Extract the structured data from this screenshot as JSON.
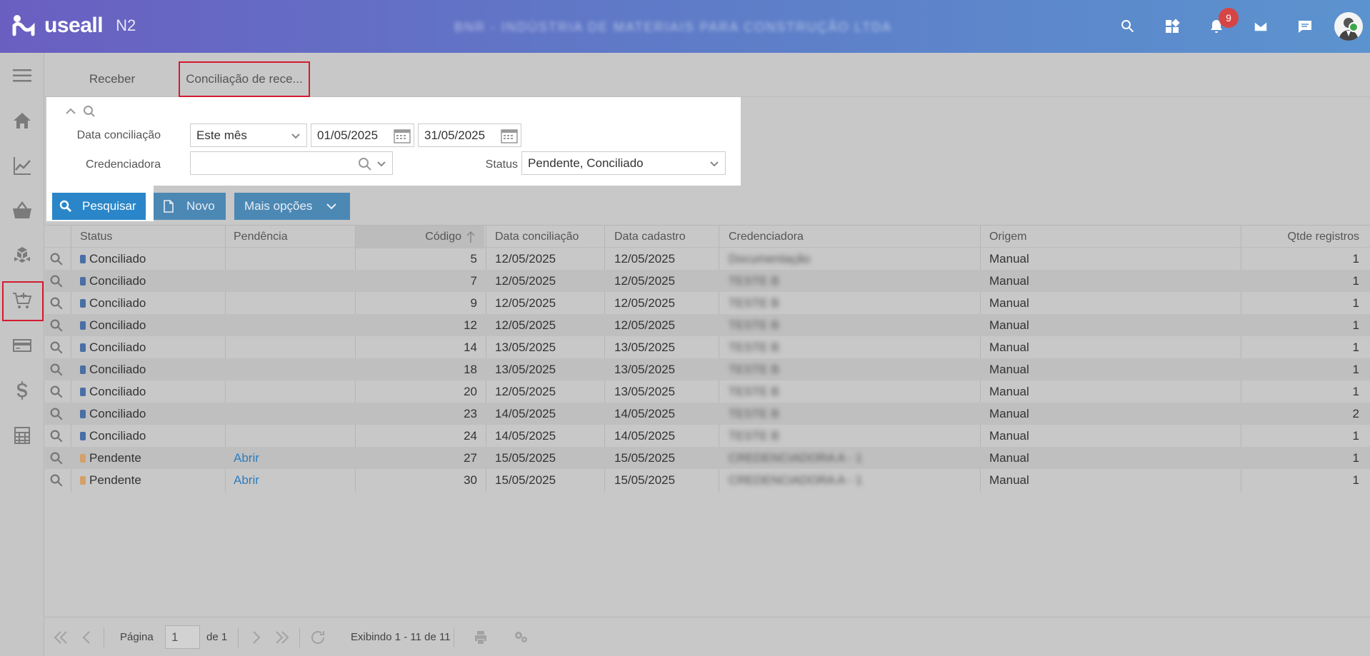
{
  "header": {
    "logo_text": "useall",
    "logo_sub": "N2",
    "company": "BNR - INDÚSTRIA DE MATERIAIS PARA CONSTRUÇÃO LTDA",
    "notification_count": "9"
  },
  "sidebar": {
    "items": [
      "menu-icon",
      "home-icon",
      "chart-icon",
      "basket-icon",
      "boxes-icon",
      "cart-icon",
      "card-icon",
      "dollar-icon",
      "calculator-icon"
    ],
    "active": "cart-icon"
  },
  "tabs": [
    {
      "label": "Receber"
    },
    {
      "label": "Conciliação de rece..."
    }
  ],
  "filter": {
    "data_label": "Data conciliação",
    "period_value": "Este mês",
    "date_from": "01/05/2025",
    "date_to": "31/05/2025",
    "cred_label": "Credenciadora",
    "cred_value": "",
    "status_label": "Status",
    "status_value": "Pendente, Conciliado"
  },
  "toolbar": {
    "search_label": "Pesquisar",
    "new_label": "Novo",
    "more_label": "Mais opções"
  },
  "grid": {
    "headers": {
      "status": "Status",
      "pendencia": "Pendência",
      "codigo": "Código",
      "data_conc": "Data conciliação",
      "data_cad": "Data cadastro",
      "cred": "Credenciadora",
      "origem": "Origem",
      "qtde": "Qtde registros"
    },
    "rows": [
      {
        "status": "Conciliado",
        "pend": "",
        "codigo": "5",
        "dc": "12/05/2025",
        "dcad": "12/05/2025",
        "cred": "Documentação",
        "origem": "Manual",
        "qtde": "1"
      },
      {
        "status": "Conciliado",
        "pend": "",
        "codigo": "7",
        "dc": "12/05/2025",
        "dcad": "12/05/2025",
        "cred": "TESTE B",
        "origem": "Manual",
        "qtde": "1"
      },
      {
        "status": "Conciliado",
        "pend": "",
        "codigo": "9",
        "dc": "12/05/2025",
        "dcad": "12/05/2025",
        "cred": "TESTE B",
        "origem": "Manual",
        "qtde": "1"
      },
      {
        "status": "Conciliado",
        "pend": "",
        "codigo": "12",
        "dc": "12/05/2025",
        "dcad": "12/05/2025",
        "cred": "TESTE B",
        "origem": "Manual",
        "qtde": "1"
      },
      {
        "status": "Conciliado",
        "pend": "",
        "codigo": "14",
        "dc": "13/05/2025",
        "dcad": "13/05/2025",
        "cred": "TESTE B",
        "origem": "Manual",
        "qtde": "1"
      },
      {
        "status": "Conciliado",
        "pend": "",
        "codigo": "18",
        "dc": "13/05/2025",
        "dcad": "13/05/2025",
        "cred": "TESTE B",
        "origem": "Manual",
        "qtde": "1"
      },
      {
        "status": "Conciliado",
        "pend": "",
        "codigo": "20",
        "dc": "12/05/2025",
        "dcad": "13/05/2025",
        "cred": "TESTE B",
        "origem": "Manual",
        "qtde": "1"
      },
      {
        "status": "Conciliado",
        "pend": "",
        "codigo": "23",
        "dc": "14/05/2025",
        "dcad": "14/05/2025",
        "cred": "TESTE B",
        "origem": "Manual",
        "qtde": "2"
      },
      {
        "status": "Conciliado",
        "pend": "",
        "codigo": "24",
        "dc": "14/05/2025",
        "dcad": "14/05/2025",
        "cred": "TESTE B",
        "origem": "Manual",
        "qtde": "1"
      },
      {
        "status": "Pendente",
        "pend": "Abrir",
        "codigo": "27",
        "dc": "15/05/2025",
        "dcad": "15/05/2025",
        "cred": "CREDENCIADORA A - 1",
        "origem": "Manual",
        "qtde": "1"
      },
      {
        "status": "Pendente",
        "pend": "Abrir",
        "codigo": "30",
        "dc": "15/05/2025",
        "dcad": "15/05/2025",
        "cred": "CREDENCIADORA A - 1",
        "origem": "Manual",
        "qtde": "1"
      }
    ]
  },
  "footer": {
    "page_label": "Página",
    "page_value": "1",
    "of_label": "de 1",
    "showing": "Exibindo 1 - 11 de 11"
  },
  "colors": {
    "conciliado": "#4a6fa5",
    "pendente": "#d4a06a",
    "primary_button": "#2a86c9",
    "highlight": "#d41b30"
  }
}
